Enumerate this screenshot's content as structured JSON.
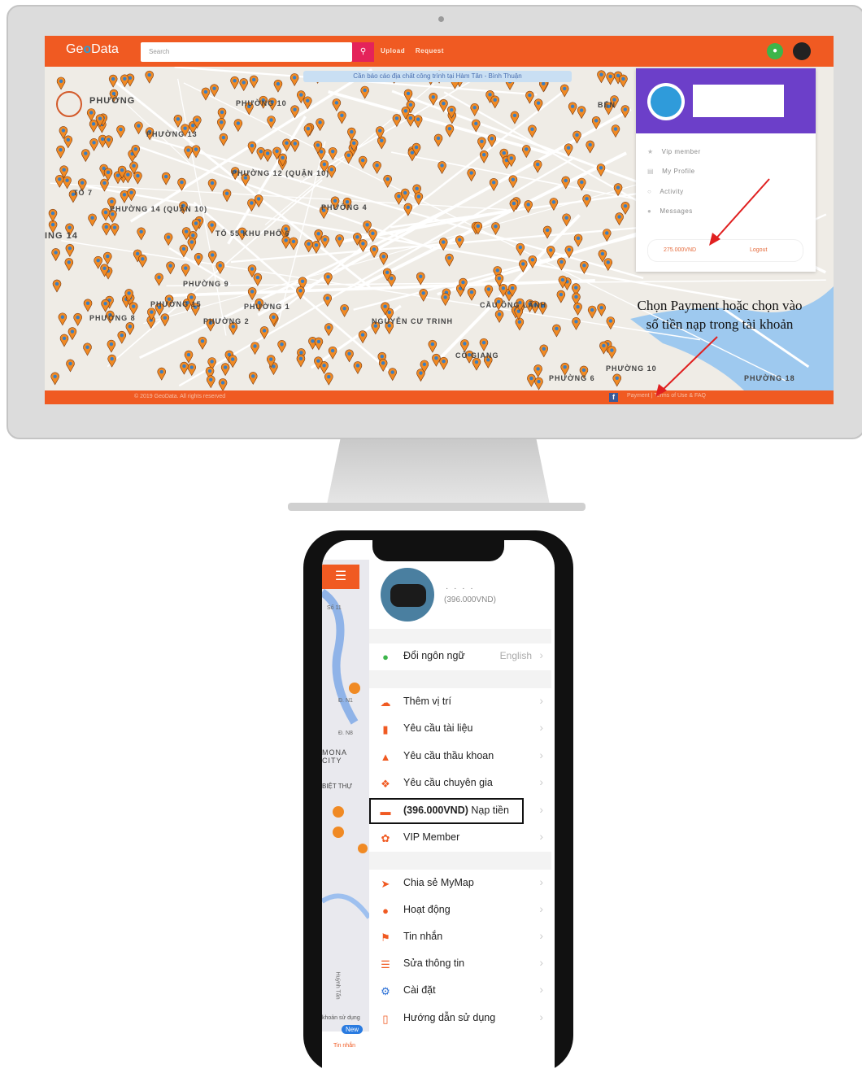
{
  "desktop": {
    "logo_part1": "Ge",
    "logo_part2": "o",
    "logo_part3": "Data",
    "search_placeholder": "Search",
    "nav": [
      "Upload",
      "Request"
    ],
    "notice": "Cần báo cáo địa chất công trình tại Hàm Tân - Bình Thuận",
    "districts": [
      "PHƯỜNG",
      "PHƯỜNG 13",
      "PHƯỜNG 12 (QUẬN 10)",
      "PHƯỜNG 10",
      "PHƯỜNG 4",
      "PHƯỜNG 14 (QUẬN 10)",
      "TỔ 55 KHU PHỐ 6",
      "PHƯỜNG 9",
      "PHƯỜNG 15",
      "PHƯỜNG 8",
      "PHƯỜNG 1",
      "PHƯỜNG 2",
      "NGUYỄN CƯ TRINH",
      "CẦU ÔNG LÃNH",
      "CÔ GIANG",
      "PHƯỜNG 6",
      "PHƯỜNG 10",
      "PHƯỜNG 18",
      "BẾN",
      "ING 14",
      "TỔ 7"
    ],
    "dropdown": {
      "items": [
        {
          "icon": "star-icon",
          "label": "Vip member"
        },
        {
          "icon": "profile-icon",
          "label": "My Profile"
        },
        {
          "icon": "activity-icon",
          "label": "Activity"
        },
        {
          "icon": "message-icon",
          "label": "Messages"
        }
      ],
      "balance": "275.000VND",
      "logout": "Logout"
    },
    "footer_left": "© 2019 GeoData. All rights reserved",
    "footer_links": "Payment | Terms of Use & FAQ",
    "annotation": [
      "Chọn Payment hoặc chọn vào",
      "số tiền nạp trong tài khoản"
    ],
    "colors": {
      "brand": "#f05a22",
      "dropdown_header": "#6c3fc9",
      "pin": "#f08a24"
    }
  },
  "phone": {
    "balance": "(396.000VND)",
    "menu": [
      {
        "icon": "globe-icon",
        "label": "Đổi ngôn ngữ",
        "value": "English"
      },
      {
        "icon": "cloud-upload-icon",
        "label": "Thêm vị trí"
      },
      {
        "icon": "document-icon",
        "label": "Yêu cầu tài liệu"
      },
      {
        "icon": "flask-icon",
        "label": "Yêu cầu thầu khoan"
      },
      {
        "icon": "lifebuoy-icon",
        "label": "Yêu cầu chuyên gia"
      },
      {
        "icon": "card-icon",
        "label_bold": "(396.000VND)",
        "label": " Nạp tiền"
      },
      {
        "icon": "ribbon-icon",
        "label": "VIP Member"
      },
      {
        "icon": "share-icon",
        "label": "Chia sẻ MyMap"
      },
      {
        "icon": "activity-icon",
        "label": "Hoạt động"
      },
      {
        "icon": "bell-icon",
        "label": "Tin nhắn"
      },
      {
        "icon": "sliders-icon",
        "label": "Sửa thông tin"
      },
      {
        "icon": "gear-icon",
        "label": "Cài đặt"
      },
      {
        "icon": "book-icon",
        "label": "Hướng dẫn sử dụng"
      }
    ],
    "map_labels": [
      "Số 11",
      "Đ. N1",
      "Đ. N8",
      "MONA CITY",
      "BIỆT THỰ",
      "Huỳnh Tấn"
    ],
    "tab_new": "New",
    "tab_label": "Tin nhắn",
    "tab_terms": "khoản sử dụng"
  }
}
